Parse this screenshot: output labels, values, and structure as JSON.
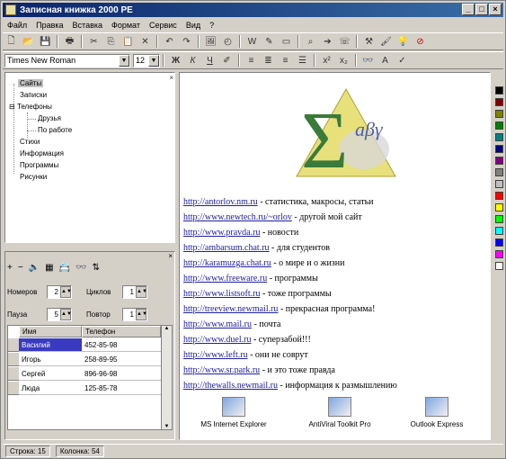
{
  "window": {
    "title": "Записная книжка 2000 PE",
    "min": "_",
    "max": "□",
    "close": "×"
  },
  "menu": [
    "Файл",
    "Правка",
    "Вставка",
    "Формат",
    "Сервис",
    "Вид",
    "?"
  ],
  "toolbar2": {
    "font": "Times New Roman",
    "size": "12",
    "bold": "Ж",
    "italic": "К",
    "underline": "Ч",
    "a_label": "A"
  },
  "tree": {
    "items": [
      "Сайты",
      "Записки",
      "Телефоны",
      "Друзья",
      "По работе",
      "Стихи",
      "Информация",
      "Программы",
      "Рисунки"
    ]
  },
  "panel": {
    "nomerov_label": "Номеров",
    "nomerov_value": "2",
    "ciklov_label": "Циклов",
    "ciklov_value": "1",
    "pauza_label": "Пауза",
    "pauza_value": "5",
    "povtor_label": "Повтор",
    "povtor_value": "1",
    "columns": [
      "Имя",
      "Телефон"
    ],
    "rows": [
      {
        "name": "Василий",
        "phone": "452-85-98"
      },
      {
        "name": "Игорь",
        "phone": "258-89-95"
      },
      {
        "name": "Сергей",
        "phone": "896-96-98"
      },
      {
        "name": "Люда",
        "phone": "125-85-78"
      }
    ]
  },
  "links": [
    {
      "url": "http://antorlov.nm.ru",
      "desc": " - статистика, макросы, статьи"
    },
    {
      "url": "http://www.newtech.ru/~orlov",
      "desc": " - другой мой сайт"
    },
    {
      "url": "http://www.pravda.ru",
      "desc": " - новости"
    },
    {
      "url": "http://ambarsum.chat.ru",
      "desc": " - для студентов"
    },
    {
      "url": "http://karamuzga.chat.ru",
      "desc": " - о мире и о жизни"
    },
    {
      "url": "http://www.freeware.ru",
      "desc": " - программы"
    },
    {
      "url": "http://www.listsoft.ru",
      "desc": " - тоже программы"
    },
    {
      "url": "http://treeview.newmail.ru",
      "desc": " - прекрасная программа!"
    },
    {
      "url": "http://www.mail.ru",
      "desc": " - почта"
    },
    {
      "url": "http://www.duel.ru",
      "desc": " - суперзабой!!!"
    },
    {
      "url": "http://www.left.ru",
      "desc": " - они не соврут"
    },
    {
      "url": "http://www.sr.park.ru",
      "desc": " - и это тоже правда"
    },
    {
      "url": "http://thewalls.newmail.ru",
      "desc": " - информация к размышлению"
    }
  ],
  "shortcuts": [
    "MS Internet Explorer",
    "AntiViral Toolkit Pro",
    "Outlook Express"
  ],
  "status": {
    "row": "Строка: 15",
    "col": "Колонка: 54"
  },
  "palette": [
    "#000000",
    "#800000",
    "#808000",
    "#008000",
    "#008080",
    "#000080",
    "#800080",
    "#808080",
    "#c0c0c0",
    "#ff0000",
    "#ffff00",
    "#00ff00",
    "#00ffff",
    "#0000ff",
    "#ff00ff",
    "#ffffff"
  ]
}
